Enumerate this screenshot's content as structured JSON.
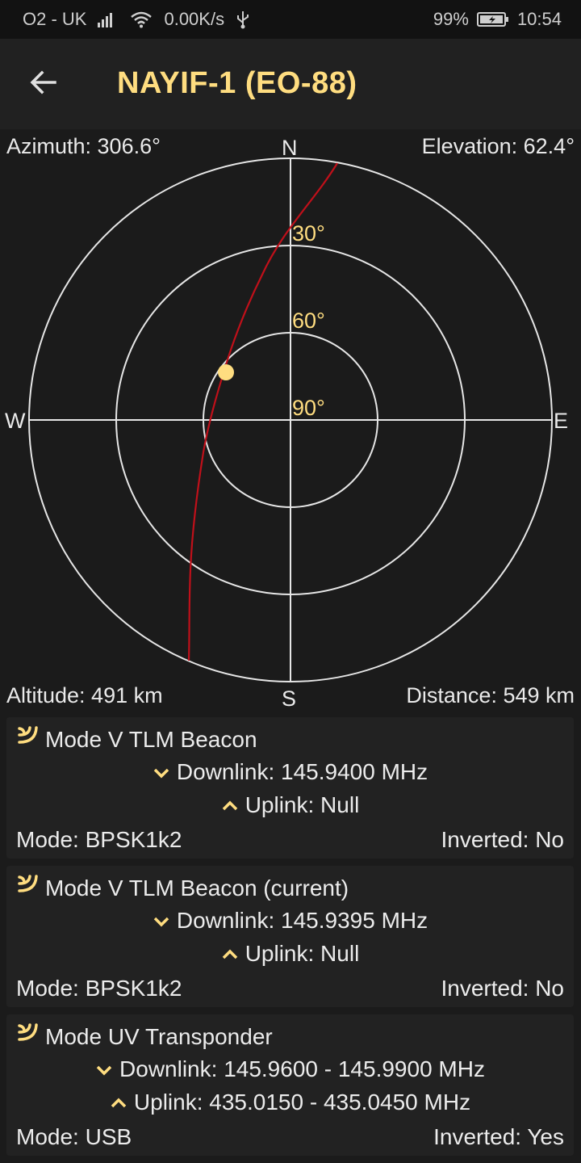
{
  "status_bar": {
    "carrier": "O2 - UK",
    "net_speed": "0.00K/s",
    "battery": "99%",
    "time": "10:54"
  },
  "app_bar": {
    "title": "NAYIF-1 (EO-88)",
    "back_icon": "arrow-back-icon"
  },
  "radar": {
    "azimuth": "Azimuth: 306.6°",
    "elevation": "Elevation: 62.4°",
    "altitude": "Altitude: 491 km",
    "distance": "Distance: 549 km",
    "compass": {
      "n": "N",
      "s": "S",
      "e": "E",
      "w": "W"
    },
    "rings": [
      "30°",
      "60°",
      "90°"
    ],
    "track_color": "#c0101a",
    "satellite_color": "#ffdd80"
  },
  "transmitters": [
    {
      "name": "Mode V TLM Beacon",
      "downlink": "Downlink: 145.9400 MHz",
      "uplink": "Uplink: Null",
      "mode": "Mode: BPSK1k2",
      "inverted": "Inverted: No"
    },
    {
      "name": "Mode V TLM Beacon (current)",
      "downlink": "Downlink: 145.9395 MHz",
      "uplink": "Uplink: Null",
      "mode": "Mode: BPSK1k2",
      "inverted": "Inverted: No"
    },
    {
      "name": "Mode UV Transponder",
      "downlink": "Downlink: 145.9600 - 145.9900 MHz",
      "uplink": "Uplink: 435.0150 - 435.0450 MHz",
      "mode": "Mode: USB",
      "inverted": "Inverted: Yes"
    }
  ],
  "colors": {
    "accent": "#ffdd80",
    "background": "#1b1b1b",
    "card": "#222222"
  }
}
